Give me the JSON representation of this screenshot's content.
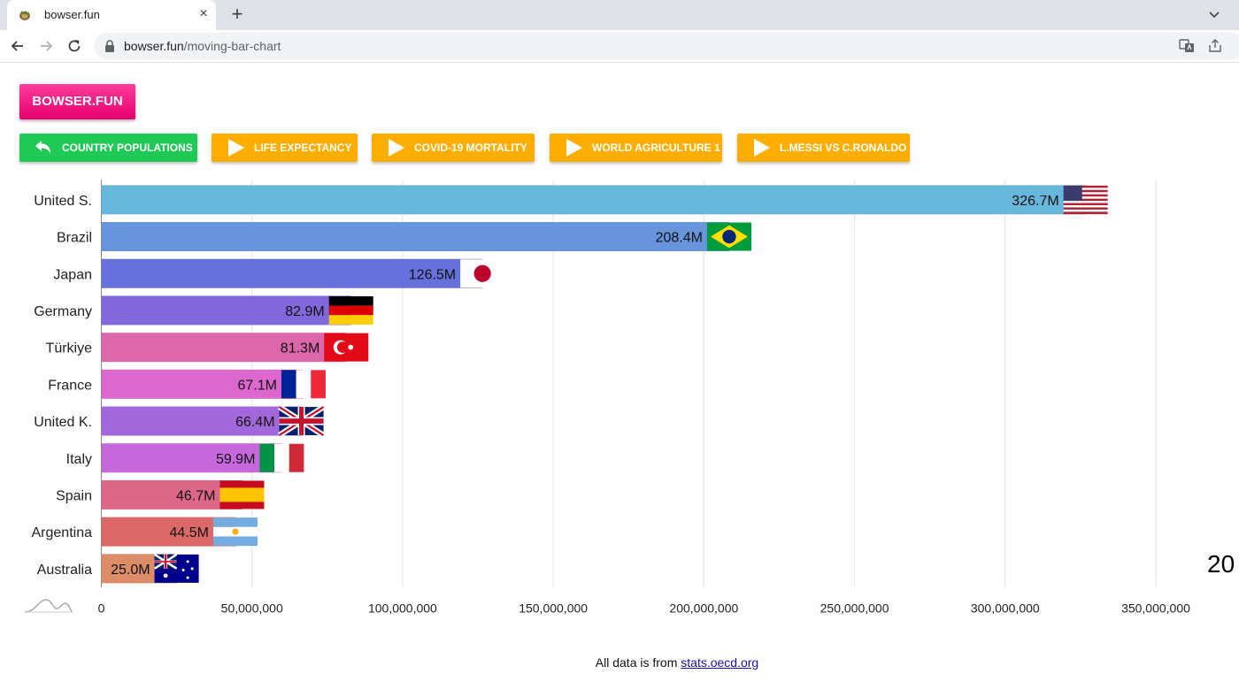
{
  "browser": {
    "tab_title": "bowser.fun",
    "new_tab_symbol": "+",
    "close_symbol": "×",
    "url_host": "bowser.fun",
    "url_path": "/moving-bar-chart"
  },
  "page": {
    "brand": "BOWSER.FUN",
    "nav_buttons": [
      {
        "label": "COUNTRY POPULATIONS",
        "icon": "back-arrow-icon",
        "color": "#1ec956"
      },
      {
        "label": "LIFE EXPECTANCY",
        "icon": "play-icon",
        "color": "#ffae00"
      },
      {
        "label": "COVID-19 MORTALITY",
        "icon": "play-icon",
        "color": "#ffae00"
      },
      {
        "label": "WORLD AGRICULTURE 1",
        "icon": "play-icon",
        "color": "#ffae00"
      },
      {
        "label": "L.MESSI VS C.RONALDO",
        "icon": "play-icon",
        "color": "#ffae00"
      }
    ],
    "footer_text": "All data is from ",
    "footer_link": "stats.oecd.org",
    "year_label": "20"
  },
  "chart_data": {
    "type": "bar",
    "orientation": "horizontal",
    "categories": [
      "United S.",
      "Brazil",
      "Japan",
      "Germany",
      "Türkiye",
      "France",
      "United K.",
      "Italy",
      "Spain",
      "Argentina",
      "Australia"
    ],
    "values": [
      326700000,
      208400000,
      126500000,
      82900000,
      81300000,
      67100000,
      66400000,
      59900000,
      46700000,
      44500000,
      25000000
    ],
    "value_labels": [
      "326.7M",
      "208.4M",
      "126.5M",
      "82.9M",
      "81.3M",
      "67.1M",
      "66.4M",
      "59.9M",
      "46.7M",
      "44.5M",
      "25.0M"
    ],
    "colors": [
      "#67b7dc",
      "#6794dc",
      "#6771dc",
      "#8067dc",
      "#dc67ab",
      "#dc67ce",
      "#a367dc",
      "#c767dc",
      "#dc6788",
      "#dc6967",
      "#dc8c67"
    ],
    "flags": [
      "us",
      "br",
      "jp",
      "de",
      "tr",
      "fr",
      "gb",
      "it",
      "es",
      "ar",
      "au"
    ],
    "xlim": [
      0,
      350000000
    ],
    "xticks": [
      0,
      50000000,
      100000000,
      150000000,
      200000000,
      250000000,
      300000000,
      350000000
    ],
    "xtick_labels": [
      "0",
      "50,000,000",
      "100,000,000",
      "150,000,000",
      "200,000,000",
      "250,000,000",
      "300,000,000",
      "350,000,000"
    ],
    "grid": true,
    "title": "",
    "xlabel": "",
    "ylabel": ""
  }
}
